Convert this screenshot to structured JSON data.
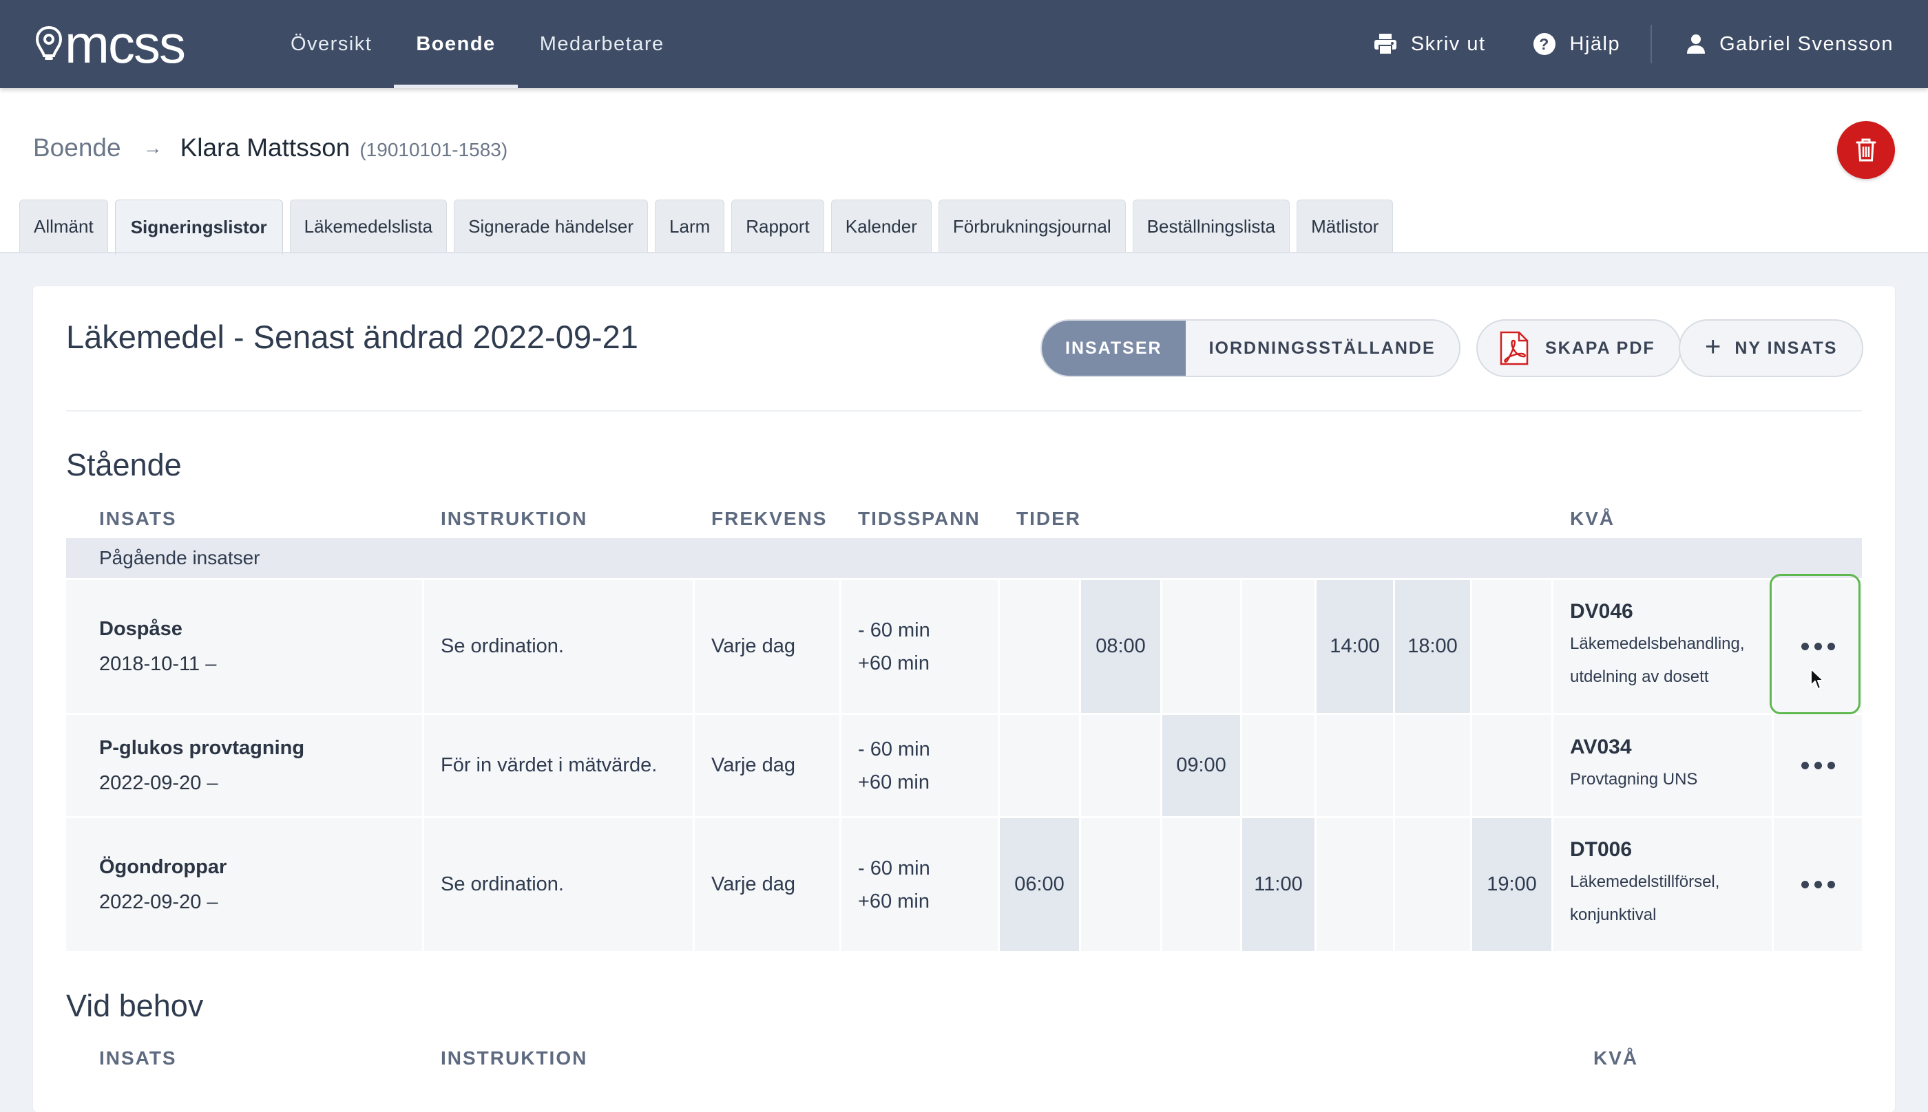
{
  "nav": {
    "logo_text": "mcss",
    "items": [
      {
        "label": "Översikt",
        "active": false
      },
      {
        "label": "Boende",
        "active": true
      },
      {
        "label": "Medarbetare",
        "active": false
      }
    ],
    "print_label": "Skriv ut",
    "help_label": "Hjälp",
    "user_name": "Gabriel Svensson"
  },
  "breadcrumb": {
    "parent": "Boende",
    "current": "Klara Mattsson",
    "id": "(19010101-1583)"
  },
  "tabs": [
    {
      "label": "Allmänt",
      "active": false
    },
    {
      "label": "Signeringslistor",
      "active": true
    },
    {
      "label": "Läkemedelslista",
      "active": false
    },
    {
      "label": "Signerade händelser",
      "active": false
    },
    {
      "label": "Larm",
      "active": false
    },
    {
      "label": "Rapport",
      "active": false
    },
    {
      "label": "Kalender",
      "active": false
    },
    {
      "label": "Förbrukningsjournal",
      "active": false
    },
    {
      "label": "Beställningslista",
      "active": false
    },
    {
      "label": "Mätlistor",
      "active": false
    }
  ],
  "card": {
    "title": "Läkemedel - Senast ändrad 2022-09-21",
    "toggle": [
      {
        "label": "INSATSER",
        "active": true
      },
      {
        "label": "IORDNINGSSTÄLLANDE",
        "active": false
      }
    ],
    "pdf_label": "SKAPA PDF",
    "new_label": "NY INSATS"
  },
  "columns": {
    "insats": "INSATS",
    "instruktion": "INSTRUKTION",
    "frekvens": "FREKVENS",
    "tidsspann": "TIDSSPANN",
    "tider": "TIDER",
    "kva": "KVÅ"
  },
  "sections": {
    "standing_title": "Stående",
    "group_label": "Pågående insatser",
    "as_needed_title": "Vid behov"
  },
  "rows": [
    {
      "name": "Dospåse",
      "date": "2018-10-11 –",
      "instruction": "Se ordination.",
      "frequency": "Varje dag",
      "span_before": "- 60 min",
      "span_after": "+60 min",
      "times": [
        "",
        "08:00",
        "",
        "",
        "14:00",
        "18:00",
        ""
      ],
      "kva_code": "DV046",
      "kva_desc_1": "Läkemedelsbehandling,",
      "kva_desc_2": "utdelning av dosett"
    },
    {
      "name": "P-glukos provtagning",
      "date": "2022-09-20 –",
      "instruction": "För in värdet i mätvärde.",
      "frequency": "Varje dag",
      "span_before": "- 60 min",
      "span_after": "+60 min",
      "times": [
        "",
        "",
        "09:00",
        "",
        "",
        "",
        ""
      ],
      "kva_code": "AV034",
      "kva_desc_1": "Provtagning UNS",
      "kva_desc_2": ""
    },
    {
      "name": "Ögondroppar",
      "date": "2022-09-20 –",
      "instruction": "Se ordination.",
      "frequency": "Varje dag",
      "span_before": "- 60 min",
      "span_after": "+60 min",
      "times": [
        "06:00",
        "",
        "",
        "11:00",
        "",
        "",
        "19:00"
      ],
      "kva_code": "DT006",
      "kva_desc_1": "Läkemedelstillförsel,",
      "kva_desc_2": "konjunktival"
    }
  ]
}
